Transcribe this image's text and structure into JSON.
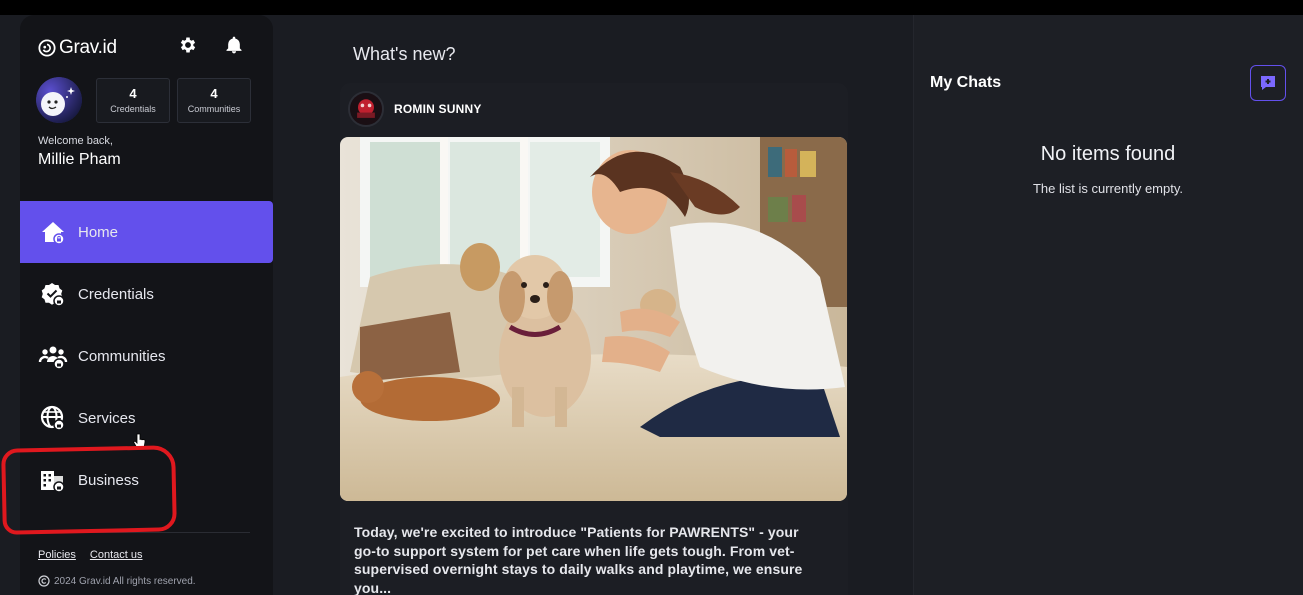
{
  "brand": {
    "name": "Grav.id",
    "accent": "#6350ec",
    "highlight": "#e0181e"
  },
  "header_icons": [
    "gear-icon",
    "bell-icon"
  ],
  "profile": {
    "stats": [
      {
        "value": "4",
        "label": "Credentials"
      },
      {
        "value": "4",
        "label": "Communities"
      }
    ],
    "welcome": "Welcome back,",
    "name": "Millie Pham"
  },
  "nav": [
    {
      "label": "Home",
      "icon": "home-icon",
      "active": true
    },
    {
      "label": "Credentials",
      "icon": "credential-badge-icon",
      "active": false
    },
    {
      "label": "Communities",
      "icon": "communities-icon",
      "active": false
    },
    {
      "label": "Services",
      "icon": "globe-icon",
      "active": false
    },
    {
      "label": "Business",
      "icon": "building-icon",
      "active": false
    }
  ],
  "footer": {
    "links": [
      "Policies",
      "Contact us"
    ],
    "copyright": "2024 Grav.id   All rights reserved."
  },
  "feed": {
    "title": "What's new?",
    "post": {
      "author": "ROMIN SUNNY",
      "text": "Today, we're excited to introduce \"Patients for PAWRENTS\" - your go-to support system for pet care when life gets tough. From vet-supervised overnight stays to daily walks and playtime, we ensure you..."
    }
  },
  "chats": {
    "title": "My Chats",
    "empty_title": "No items found",
    "empty_subtitle": "The list is currently empty."
  }
}
